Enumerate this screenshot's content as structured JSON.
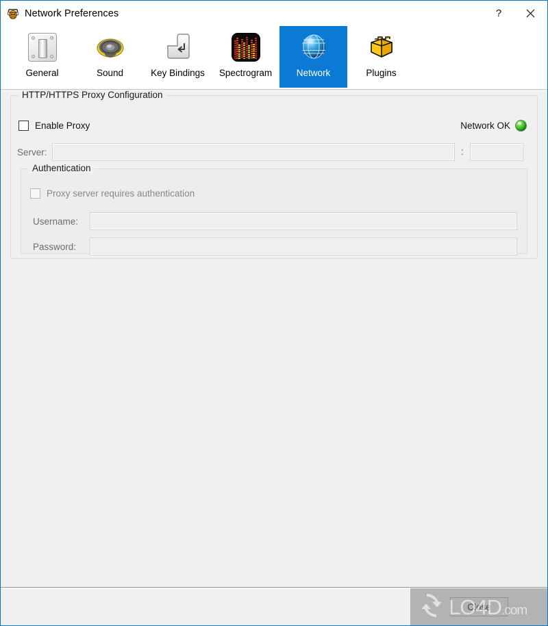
{
  "window": {
    "title": "Network Preferences",
    "app_icon": "bee-headphones-icon",
    "help_label": "?",
    "close_label": "✕",
    "accent_color": "#0b7ad4",
    "border_color": "#0d74c4"
  },
  "toolbar": {
    "tabs": [
      {
        "label": "General",
        "icon": "light-switch-icon",
        "selected": false
      },
      {
        "label": "Sound",
        "icon": "speaker-icon",
        "selected": false
      },
      {
        "label": "Key Bindings",
        "icon": "enter-key-icon",
        "selected": false
      },
      {
        "label": "Spectrogram",
        "icon": "equalizer-icon",
        "selected": false
      },
      {
        "label": "Network",
        "icon": "globe-icon",
        "selected": true
      },
      {
        "label": "Plugins",
        "icon": "lego-brick-icon",
        "selected": false
      }
    ]
  },
  "proxy": {
    "group_title": "HTTP/HTTPS Proxy Configuration",
    "enable_proxy_label": "Enable Proxy",
    "enable_proxy_checked": false,
    "server_label": "Server:",
    "server_value": "",
    "server_placeholder": "",
    "port_separator": ":",
    "port_value": "",
    "port_placeholder": "",
    "status_text": "Network OK",
    "status_color": "#3cc21e",
    "status_icon": "green-led-icon"
  },
  "authentication": {
    "group_title": "Authentication",
    "requires_auth_label": "Proxy server requires authentication",
    "requires_auth_checked": false,
    "requires_auth_enabled": false,
    "username_label": "Username:",
    "username_value": "",
    "username_placeholder": "",
    "password_label": "Password:",
    "password_value": "",
    "password_placeholder": ""
  },
  "footer": {
    "close_label": "Close"
  },
  "watermark": {
    "brand": "LO4D",
    "domain": ".com",
    "logo_icon": "recycle-arrows-icon"
  }
}
